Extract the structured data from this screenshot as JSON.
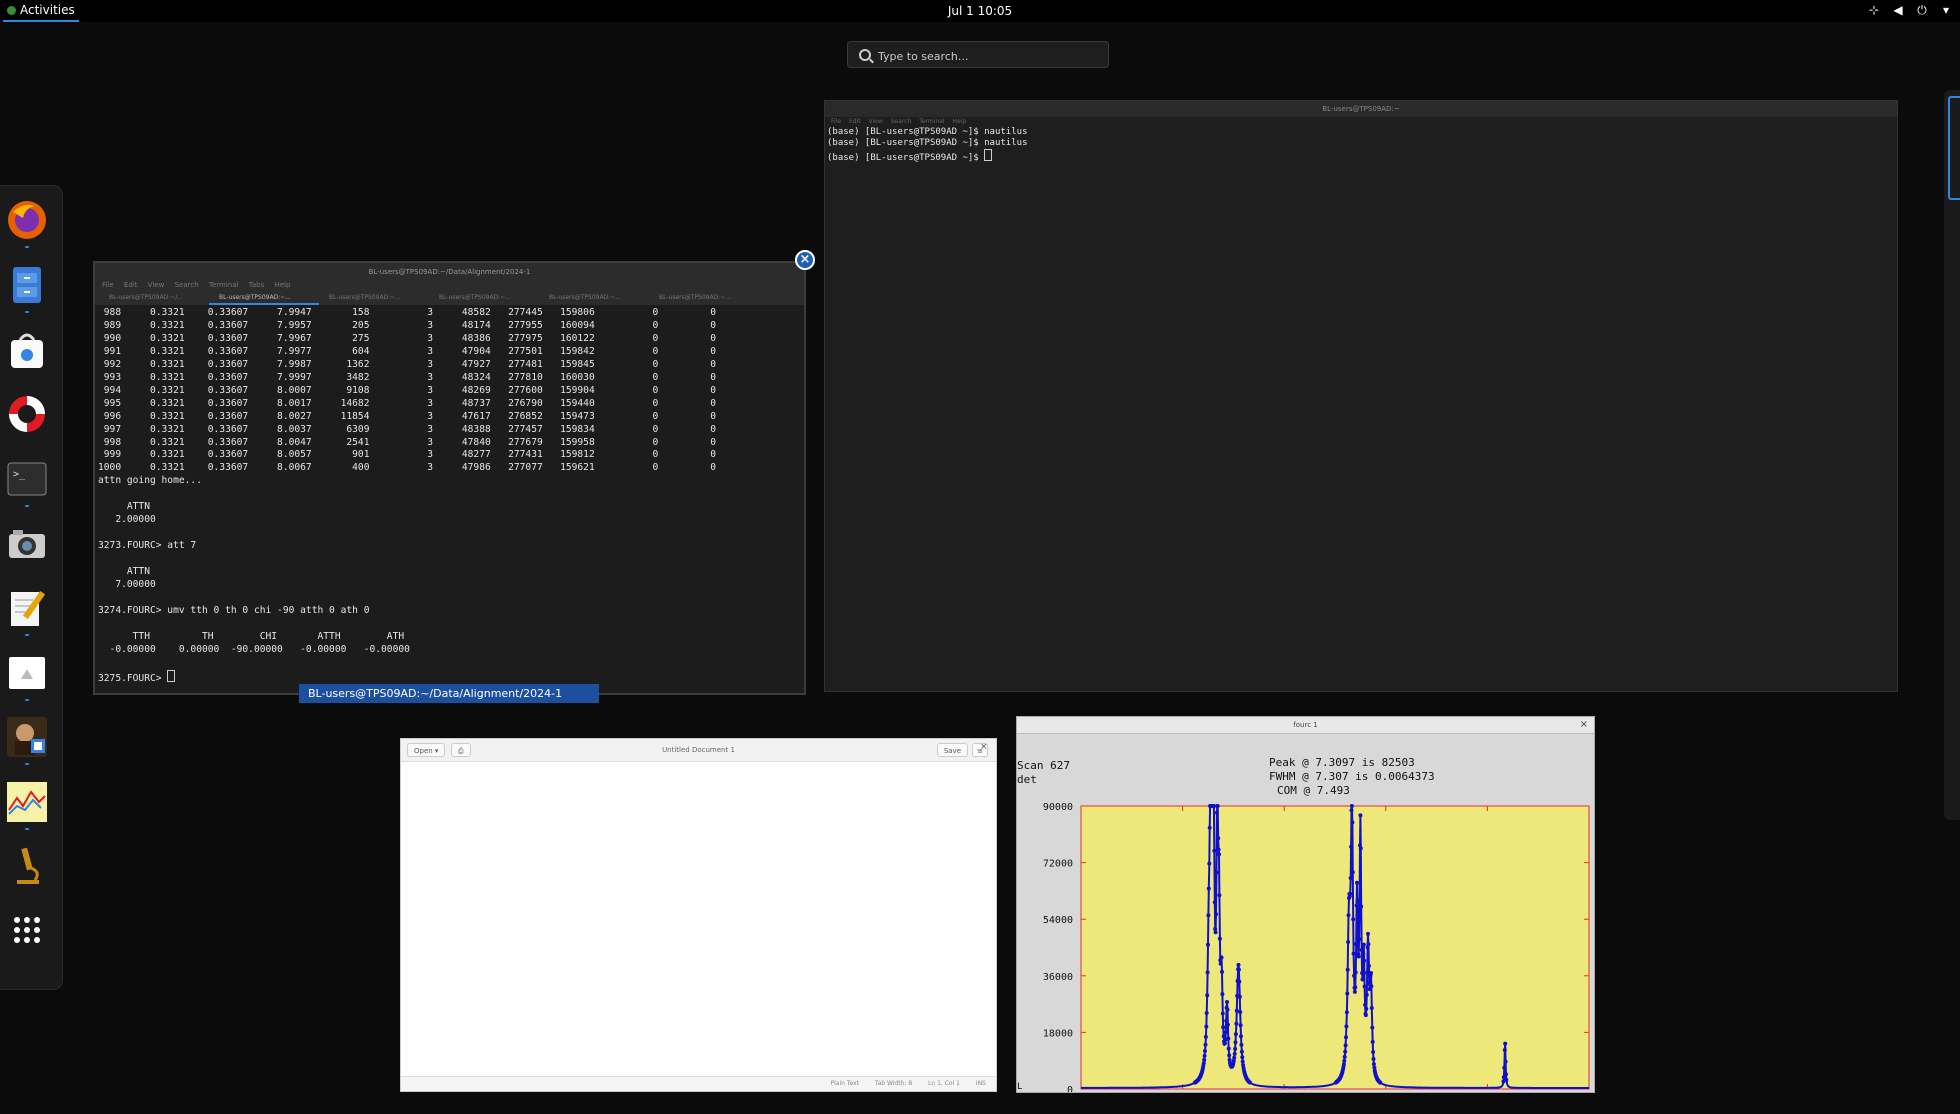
{
  "topbar": {
    "activities": "Activities",
    "clock": "Jul 1  10:05",
    "tray_icons": [
      "network-icon",
      "volume-icon",
      "power-icon",
      "chevron-down-icon"
    ]
  },
  "search": {
    "placeholder": "Type to search..."
  },
  "dock": {
    "apps": [
      "firefox-icon",
      "file-cabinet-icon",
      "software-store-icon",
      "help-lifebuoy-icon",
      "terminal-icon",
      "camera-icon",
      "text-editor-icon",
      "image-viewer-icon",
      "portrait-app-icon",
      "chart-app-icon",
      "microscope-icon",
      "app-grid-icon"
    ]
  },
  "terminal_right": {
    "title": "BL-users@TPS09AD:~",
    "menu": [
      "File",
      "Edit",
      "View",
      "Search",
      "Terminal",
      "Help"
    ],
    "lines": [
      "(base) [BL-users@TPS09AD ~]$ nautilus",
      "(base) [BL-users@TPS09AD ~]$ nautilus",
      "(base) [BL-users@TPS09AD ~]$ "
    ]
  },
  "terminal_left": {
    "title": "BL-users@TPS09AD:~/Data/Alignment/2024-1",
    "menu": [
      "File",
      "Edit",
      "View",
      "Search",
      "Terminal",
      "Tabs",
      "Help"
    ],
    "tabs": [
      "BL-users@TPS09AD:~/...",
      "BL-users@TPS09AD:~...",
      "BL-users@TPS09AD:~...",
      "BL-users@TPS09AD:~...",
      "BL-users@TPS09AD:~...",
      "BL-users@TPS09AD:~..."
    ],
    "lines": [
      " 988     0.3321    0.33607     7.9947       158          3     48582   277445   159806          0         0",
      " 989     0.3321    0.33607     7.9957       205          3     48174   277955   160094          0         0",
      " 990     0.3321    0.33607     7.9967       275          3     48386   277975   160122          0         0",
      " 991     0.3321    0.33607     7.9977       604          3     47904   277501   159842          0         0",
      " 992     0.3321    0.33607     7.9987      1362          3     47927   277481   159845          0         0",
      " 993     0.3321    0.33607     7.9997      3482          3     48324   277810   160030          0         0",
      " 994     0.3321    0.33607     8.0007      9108          3     48269   277600   159904          0         0",
      " 995     0.3321    0.33607     8.0017     14682          3     48737   276790   159440          0         0",
      " 996     0.3321    0.33607     8.0027     11854          3     47617   276852   159473          0         0",
      " 997     0.3321    0.33607     8.0037      6309          3     48388   277457   159834          0         0",
      " 998     0.3321    0.33607     8.0047      2541          3     47840   277679   159958          0         0",
      " 999     0.3321    0.33607     8.0057       901          3     48277   277431   159812          0         0",
      "1000     0.3321    0.33607     8.0067       400          3     47986   277077   159621          0         0",
      "attn going home...",
      "",
      "     ATTN",
      "   2.00000",
      "",
      "3273.FOURC> att 7",
      "",
      "     ATTN",
      "   7.00000",
      "",
      "3274.FOURC> umv tth 0 th 0 chi -90 atth 0 ath 0",
      "",
      "      TTH         TH        CHI       ATTH        ATH",
      "  -0.00000    0.00000  -90.00000   -0.00000   -0.00000",
      ""
    ],
    "prompt": "3275.FOURC> ",
    "window_label": "BL-users@TPS09AD:~/Data/Alignment/2024-1"
  },
  "editor": {
    "title": "Untitled Document 1",
    "open_label": "Open",
    "save_label": "Save",
    "status": [
      "Plain Text",
      "Tab Width: 8",
      "Ln 1, Col 1",
      "INS"
    ]
  },
  "plot": {
    "window_title": "fourc 1",
    "scan_label": "Scan 627",
    "det_label": "det",
    "peak_line": "Peak @ 7.3097 is 82503",
    "fwhm_line": "FWHM @ 7.307 is 0.0064373",
    "com_line": "COM @ 7.493",
    "corner_label": "L",
    "colors": {
      "background": "#eee87a",
      "frame": "#e03030",
      "line": "#1010cc"
    }
  },
  "chart_data": {
    "type": "line",
    "xlim": [
      7,
      8.2
    ],
    "ylim": [
      0,
      90000
    ],
    "xticks": [
      "7",
      "7.24",
      "7.48",
      "7.72",
      "7.96",
      "8.2"
    ],
    "yticks": [
      "0",
      "18000",
      "36000",
      "54000",
      "72000",
      "90000"
    ],
    "peaks": [
      {
        "x": 7.302,
        "h": 36000,
        "w": 0.004
      },
      {
        "x": 7.306,
        "h": 60000,
        "w": 0.002
      },
      {
        "x": 7.3097,
        "h": 82503,
        "w": 0.0032
      },
      {
        "x": 7.314,
        "h": 45000,
        "w": 0.002
      },
      {
        "x": 7.322,
        "h": 78000,
        "w": 0.0025
      },
      {
        "x": 7.326,
        "h": 40000,
        "w": 0.002
      },
      {
        "x": 7.332,
        "h": 28000,
        "w": 0.003
      },
      {
        "x": 7.345,
        "h": 22000,
        "w": 0.003
      },
      {
        "x": 7.372,
        "h": 38000,
        "w": 0.005
      },
      {
        "x": 7.633,
        "h": 45000,
        "w": 0.004
      },
      {
        "x": 7.64,
        "h": 78000,
        "w": 0.0032
      },
      {
        "x": 7.652,
        "h": 50000,
        "w": 0.0025
      },
      {
        "x": 7.66,
        "h": 75000,
        "w": 0.0025
      },
      {
        "x": 7.668,
        "h": 32000,
        "w": 0.0025
      },
      {
        "x": 7.678,
        "h": 40000,
        "w": 0.003
      },
      {
        "x": 7.685,
        "h": 28000,
        "w": 0.003
      },
      {
        "x": 8.0017,
        "h": 14682,
        "w": 0.0015
      }
    ]
  }
}
